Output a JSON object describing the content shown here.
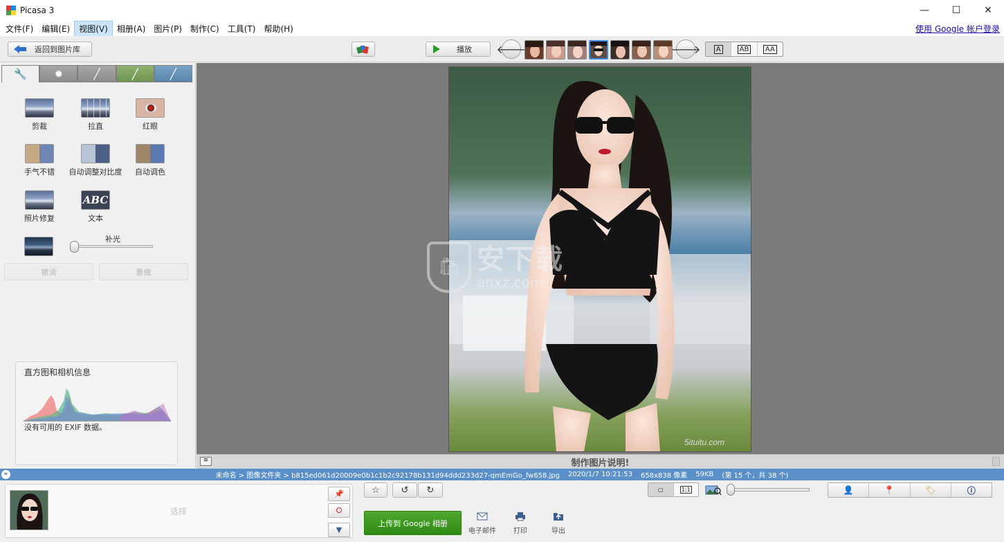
{
  "window": {
    "title": "Picasa 3",
    "controls": {
      "minimize": "—",
      "maximize": "☐",
      "close": "✕"
    }
  },
  "menu": {
    "items": [
      "文件(F)",
      "编辑(E)",
      "视图(V)",
      "相册(A)",
      "图片(P)",
      "制作(C)",
      "工具(T)",
      "帮助(H)"
    ],
    "active_index": 2,
    "google_login": "使用 Google 帐户登录"
  },
  "toolbar": {
    "back_label": "返回到图片库",
    "play_label": "播放",
    "prev_arrow": "🡐",
    "next_arrow": "🡒",
    "layout_options": [
      "A",
      "AB",
      "AA"
    ],
    "selected_layout": 0,
    "thumbnails_count": 7,
    "selected_thumbnail": 3
  },
  "edit_panel": {
    "tab_icons": [
      "wrench-icon",
      "sun-icon",
      "brush-icon",
      "green-brush-icon",
      "blue-brush-icon"
    ],
    "tab_glyphs": [
      "🔧",
      "✹",
      "╱",
      "╱",
      "╱"
    ],
    "tools": {
      "crop": "剪裁",
      "straighten": "拉直",
      "redeye": "红眼",
      "lucky": "手气不错",
      "auto_contrast": "自动调整对比度",
      "auto_color": "自动调色",
      "retouch": "照片修复",
      "text": "文本",
      "text_icon": "ABC"
    },
    "fill_light_label": "补光",
    "fill_light_value": 0,
    "undo_label": "撤消",
    "redo_label": "重做",
    "histogram_title": "直方图和相机信息",
    "exif_note": "没有可用的 EXIF 数据。"
  },
  "viewer": {
    "watermark_cn": "安下载",
    "watermark_en": "anxz.com",
    "watermark_icon": "🛍"
  },
  "caption": {
    "text": "制作图片说明!"
  },
  "status": {
    "path": "未命名 > 图像文件夹 > b815ed061d20009e0b1c1b2c92178b131d94ddd233d27-qmEmGo_fw658.jpg",
    "datetime": "2020/1/7 10:21:53",
    "dimensions": "658x838 像素",
    "size": "59KB",
    "position": "(第 15 个，共 38 个)",
    "collapse_glyph": "«"
  },
  "bottom": {
    "tray_hint": "选择",
    "upload_label": "上传到 Google 相册",
    "email_label": "电子邮件",
    "print_label": "打印",
    "export_label": "导出",
    "zoom_fit": "▢",
    "zoom_actual": "1:1",
    "zoom_level": 0.02,
    "star_glyph": "☆",
    "rotate_left_glyph": "↺",
    "rotate_right_glyph": "↻",
    "pin_glyph": "📌",
    "block_glyph": "⭘",
    "album_glyph": "▼",
    "right_tab_icons": [
      "person-icon",
      "location-pin-icon",
      "tag-icon",
      "info-icon"
    ],
    "right_tab_glyphs": [
      "👤",
      "📍",
      "🏷",
      "ⓘ"
    ]
  },
  "colors": {
    "status_bar": "#5b8fc7",
    "upload_green": "#3a961e",
    "viewer_bg": "#7b7b7b"
  }
}
